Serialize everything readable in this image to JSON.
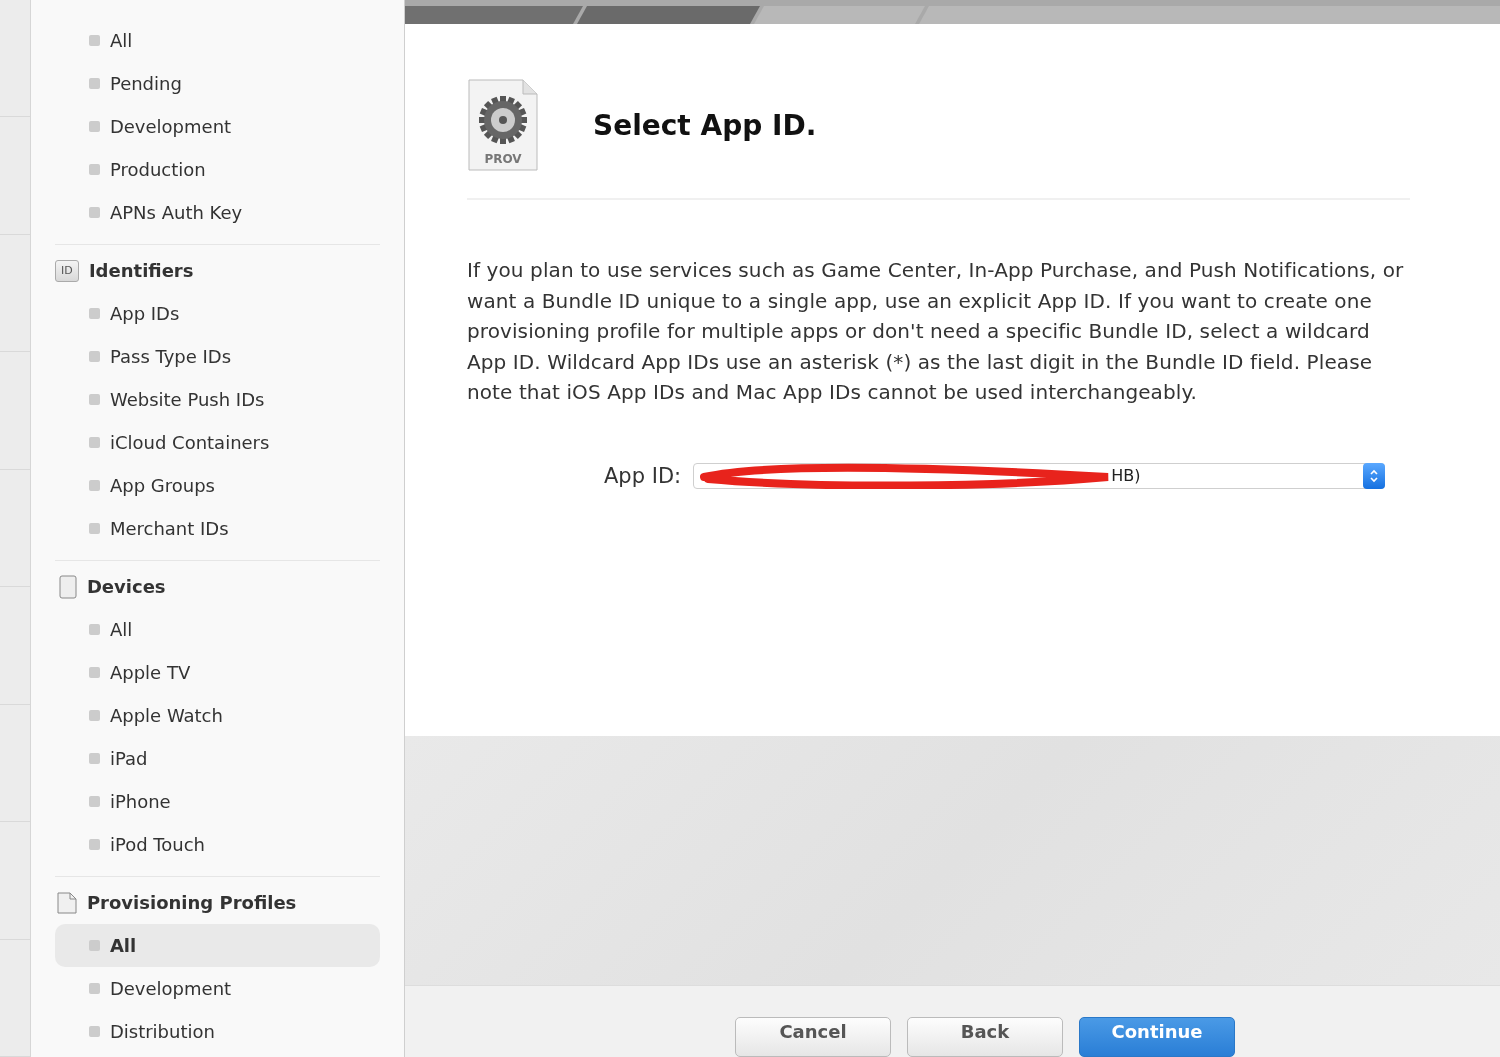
{
  "sidebar": {
    "sections": [
      {
        "items": [
          {
            "label": "All",
            "selected": false
          },
          {
            "label": "Pending",
            "selected": false
          },
          {
            "label": "Development",
            "selected": false
          },
          {
            "label": "Production",
            "selected": false
          },
          {
            "label": "APNs Auth Key",
            "selected": false
          }
        ]
      },
      {
        "kind": "identifiers",
        "title": "Identifiers",
        "badge": "ID",
        "items": [
          {
            "label": "App IDs",
            "selected": false
          },
          {
            "label": "Pass Type IDs",
            "selected": false
          },
          {
            "label": "Website Push IDs",
            "selected": false
          },
          {
            "label": "iCloud Containers",
            "selected": false
          },
          {
            "label": "App Groups",
            "selected": false
          },
          {
            "label": "Merchant IDs",
            "selected": false
          }
        ]
      },
      {
        "kind": "devices",
        "title": "Devices",
        "items": [
          {
            "label": "All",
            "selected": false
          },
          {
            "label": "Apple TV",
            "selected": false
          },
          {
            "label": "Apple Watch",
            "selected": false
          },
          {
            "label": "iPad",
            "selected": false
          },
          {
            "label": "iPhone",
            "selected": false
          },
          {
            "label": "iPod Touch",
            "selected": false
          }
        ]
      },
      {
        "kind": "profiles",
        "title": "Provisioning Profiles",
        "items": [
          {
            "label": "All",
            "selected": true
          },
          {
            "label": "Development",
            "selected": false
          },
          {
            "label": "Distribution",
            "selected": false
          }
        ]
      }
    ]
  },
  "main": {
    "icon_label": "PROV",
    "title": "Select App ID.",
    "description": "If you plan to use services such as Game Center, In-App Purchase, and Push Notifications, or want a Bundle ID unique to a single app, use an explicit App ID. If you want to create one provisioning profile for multiple apps or don't need a specific Bundle ID, select a wildcard App ID. Wildcard App IDs use an asterisk (*) as the last digit in the Bundle ID field. Please note that iOS App IDs and Mac App IDs cannot be used interchangeably.",
    "app_id": {
      "label": "App ID:",
      "value": "HB)"
    }
  },
  "buttons": [
    {
      "label": "Cancel",
      "kind": "plain"
    },
    {
      "label": "Back",
      "kind": "plain"
    },
    {
      "label": "Continue",
      "kind": "primary"
    }
  ]
}
